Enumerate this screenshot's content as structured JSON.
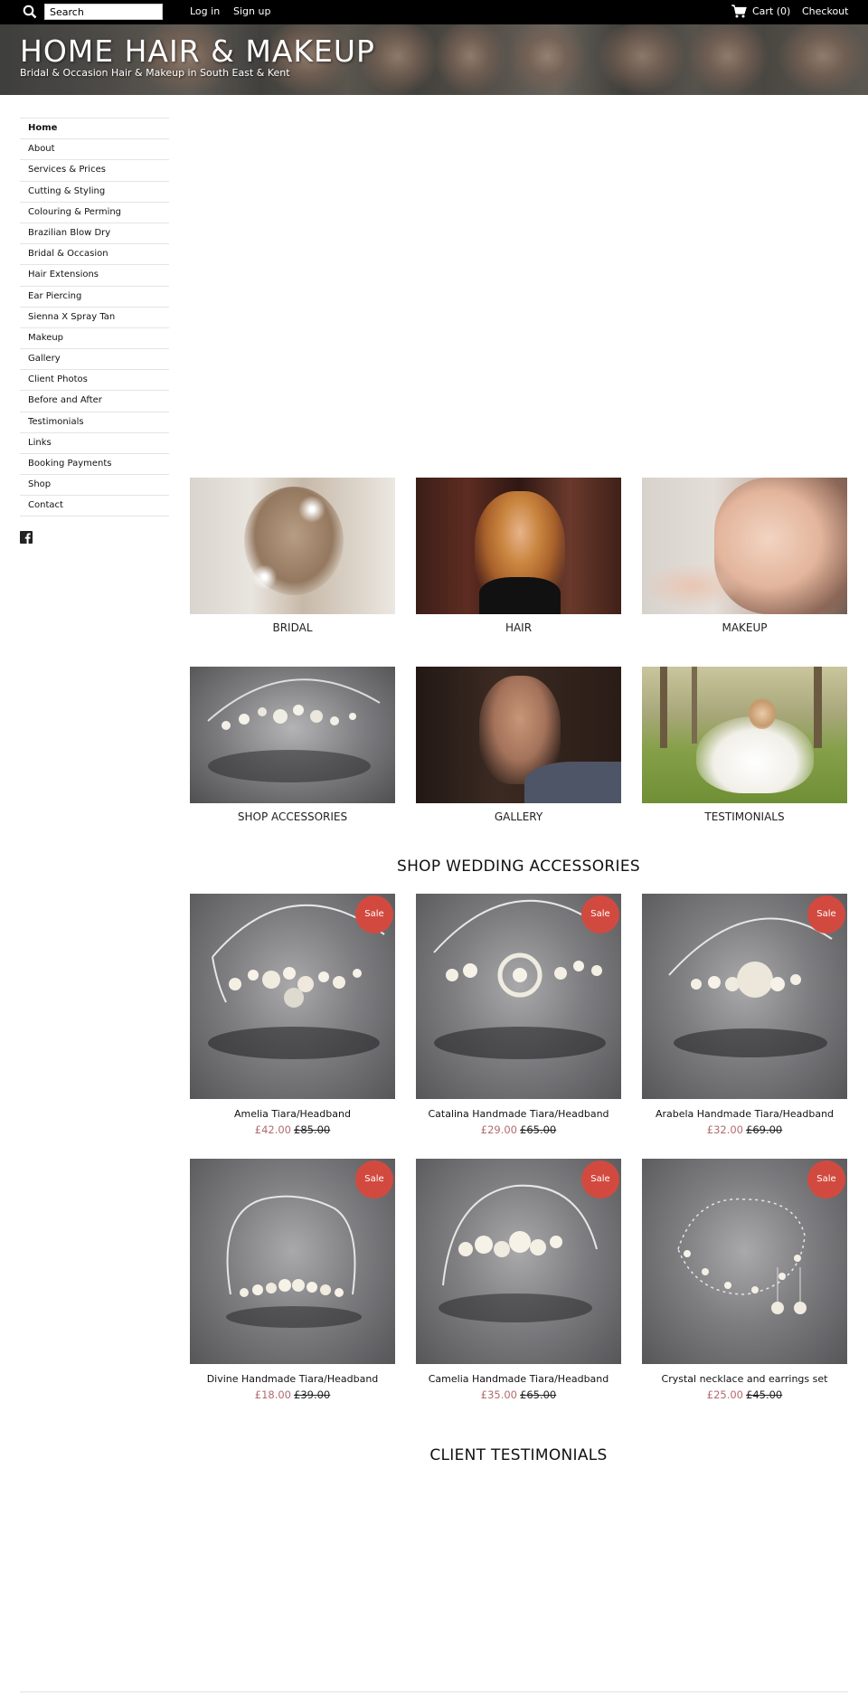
{
  "topbar": {
    "search_placeholder": "Search",
    "login": "Log in",
    "signup": "Sign up",
    "cart": "Cart (0)",
    "checkout": "Checkout"
  },
  "header": {
    "title": "HOME HAIR & MAKEUP",
    "tagline": "Bridal & Occasion Hair & Makeup in South East & Kent"
  },
  "sidebar": {
    "items": [
      {
        "label": "Home"
      },
      {
        "label": "About"
      },
      {
        "label": "Services & Prices"
      },
      {
        "label": "Cutting & Styling"
      },
      {
        "label": "Colouring & Perming"
      },
      {
        "label": "Brazilian Blow Dry"
      },
      {
        "label": "Bridal & Occasion"
      },
      {
        "label": "Hair Extensions"
      },
      {
        "label": "Ear Piercing"
      },
      {
        "label": "Sienna X Spray Tan"
      },
      {
        "label": "Makeup"
      },
      {
        "label": "Gallery"
      },
      {
        "label": "Client Photos"
      },
      {
        "label": "Before and After"
      },
      {
        "label": "Testimonials"
      },
      {
        "label": "Links"
      },
      {
        "label": "Booking Payments"
      },
      {
        "label": "Shop"
      },
      {
        "label": "Contact"
      }
    ],
    "social_icon": "facebook-icon"
  },
  "categories": [
    {
      "label": "BRIDAL"
    },
    {
      "label": "HAIR"
    },
    {
      "label": "MAKEUP"
    },
    {
      "label": "SHOP ACCESSORIES"
    },
    {
      "label": "GALLERY"
    },
    {
      "label": "TESTIMONIALS"
    }
  ],
  "shop": {
    "title": "SHOP WEDDING ACCESSORIES",
    "sale_badge": "Sale",
    "products": [
      {
        "name": "Amelia Tiara/Headband",
        "price": "£42.00",
        "compare": "£85.00"
      },
      {
        "name": "Catalina Handmade Tiara/Headband",
        "price": "£29.00",
        "compare": "£65.00"
      },
      {
        "name": "Arabela Handmade Tiara/Headband",
        "price": "£32.00",
        "compare": "£69.00"
      },
      {
        "name": "Divine Handmade Tiara/Headband",
        "price": "£18.00",
        "compare": "£39.00"
      },
      {
        "name": "Camelia Handmade Tiara/Headband",
        "price": "£35.00",
        "compare": "£65.00"
      },
      {
        "name": "Crystal necklace and earrings set",
        "price": "£25.00",
        "compare": "£45.00"
      }
    ]
  },
  "testimonials": {
    "title": "CLIENT TESTIMONIALS"
  },
  "colors": {
    "topbar": "#000000",
    "sale_badge": "#d24a3f",
    "sale_price": "#b46a6e"
  }
}
